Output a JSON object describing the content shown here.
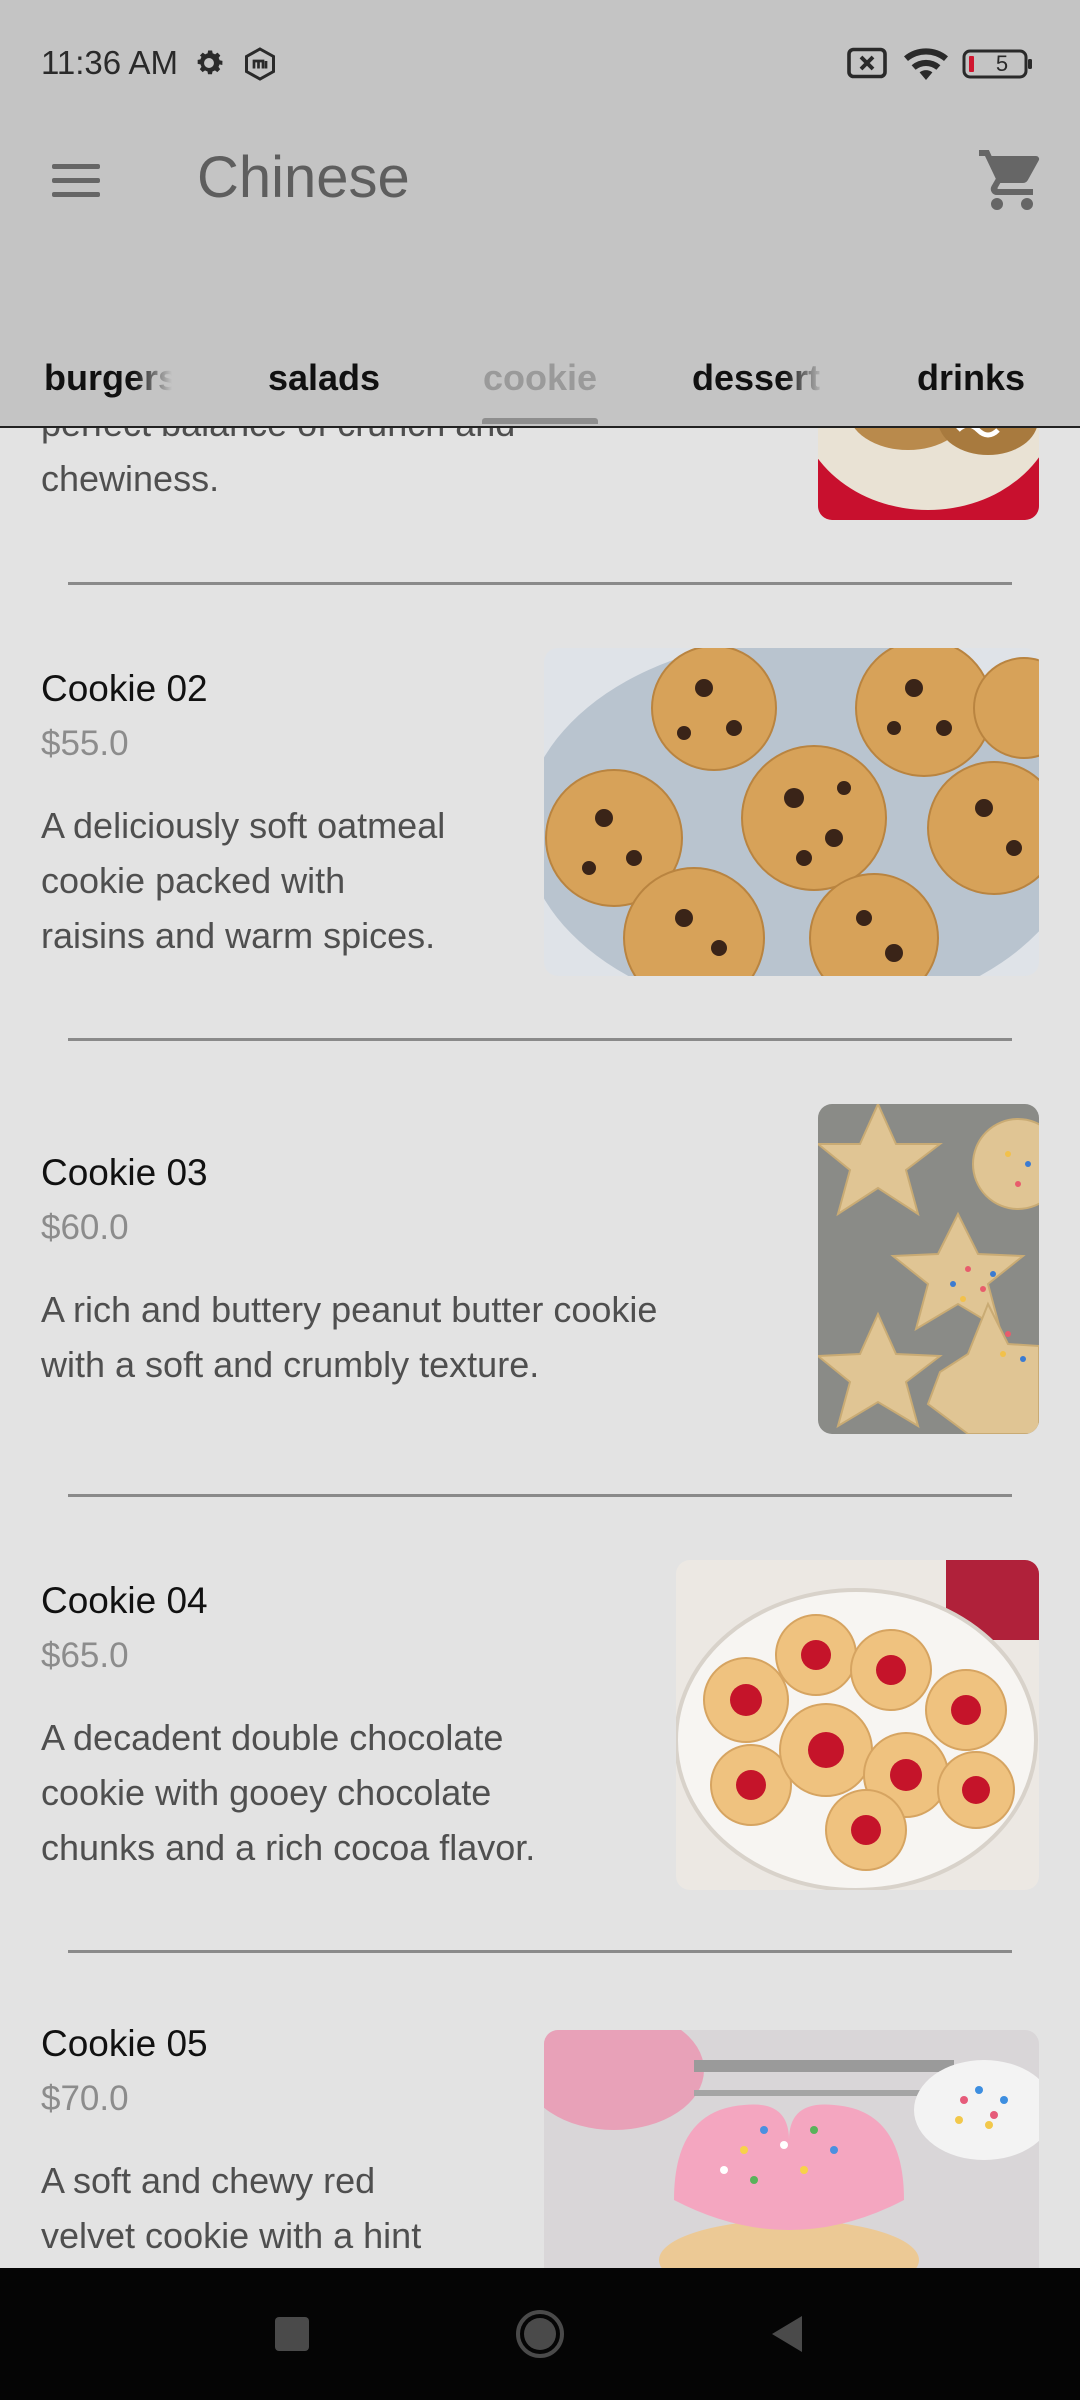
{
  "status_bar": {
    "time": "11:36 AM",
    "battery": "5",
    "icons": [
      "gear-icon",
      "mi-icon",
      "no-sim-icon",
      "wifi-icon",
      "battery-icon"
    ]
  },
  "app_bar": {
    "title": "Chinese",
    "menu_icon": "hamburger-menu-icon",
    "cart_icon": "shopping-cart-icon"
  },
  "tabs": [
    {
      "label": "burgers",
      "active": false
    },
    {
      "label": "salads",
      "active": false
    },
    {
      "label": "cookie",
      "active": true
    },
    {
      "label": "dessert",
      "active": false
    },
    {
      "label": "drinks",
      "active": false
    }
  ],
  "items": [
    {
      "name": "",
      "price": "",
      "desc_lines": [
        "perfect balance of crunch and",
        "chewiness."
      ]
    },
    {
      "name": "Cookie 02",
      "price": "$55.0",
      "desc_lines": [
        "A deliciously soft oatmeal",
        "cookie packed with",
        "raisins and warm spices."
      ]
    },
    {
      "name": "Cookie 03",
      "price": "$60.0",
      "desc_lines": [
        "A rich and buttery peanut butter cookie",
        "with a soft and crumbly texture."
      ]
    },
    {
      "name": "Cookie 04",
      "price": "$65.0",
      "desc_lines": [
        "A decadent double chocolate",
        "cookie with gooey chocolate",
        "chunks and a rich cocoa flavor."
      ]
    },
    {
      "name": "Cookie 05",
      "price": "$70.0",
      "desc_lines": [
        "A soft and chewy red",
        "velvet cookie with a hint"
      ]
    }
  ],
  "colors": {
    "app_bar_bg": "#c4c4c4",
    "content_bg": "#e3e3e3",
    "active_tab": "#9a9a9a",
    "price": "#8c8c8c"
  }
}
